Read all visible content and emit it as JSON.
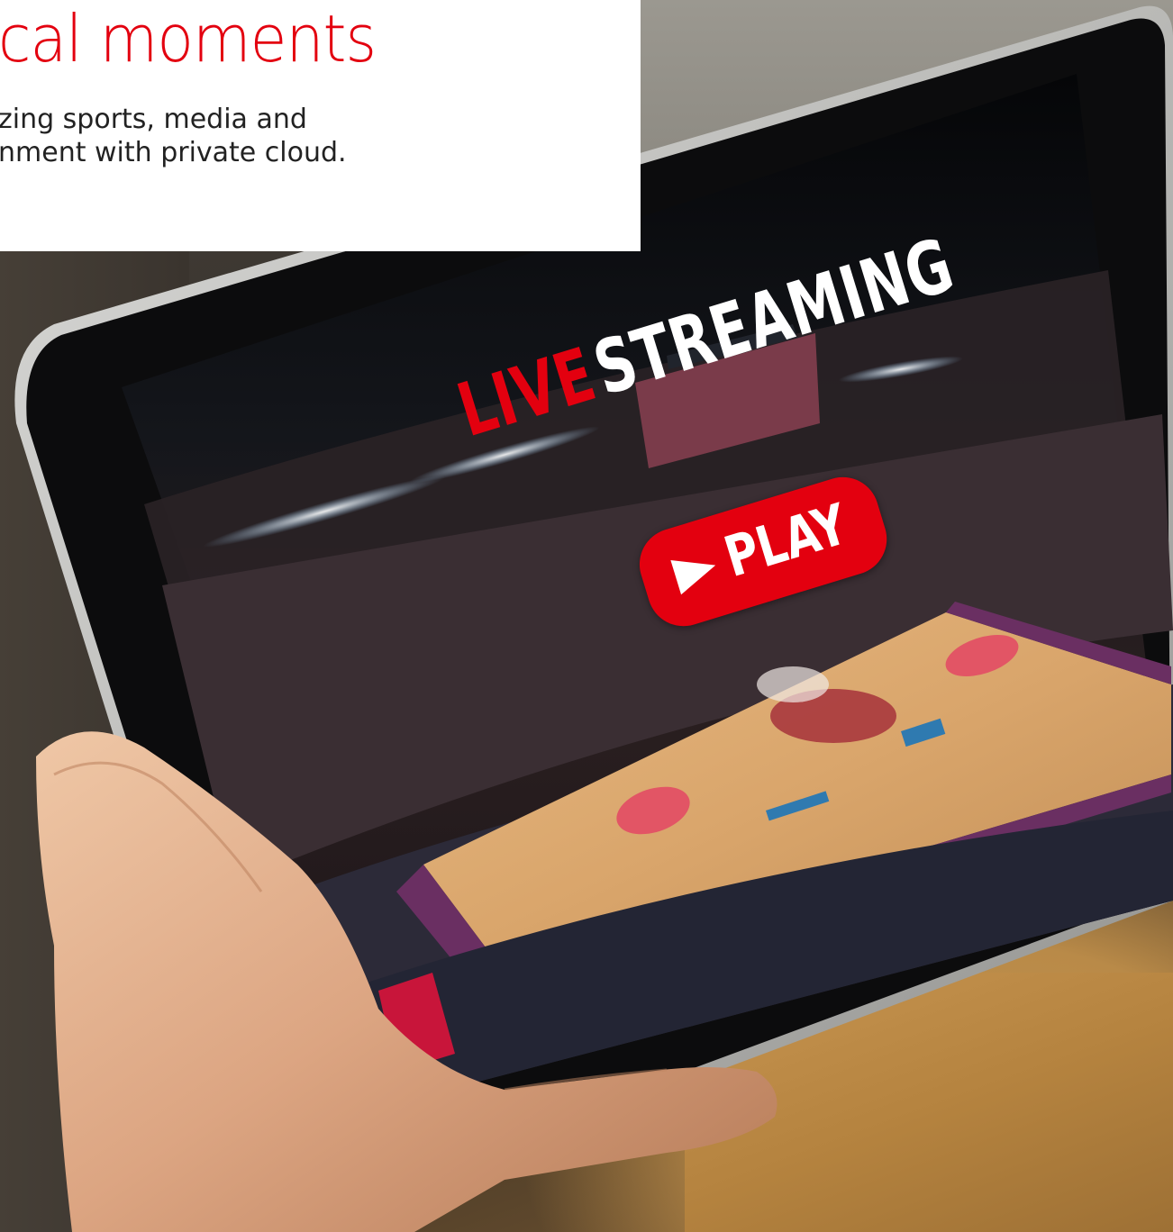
{
  "hero": {
    "title": "cal moments",
    "subtitle_line1": "zing sports, media and",
    "subtitle_line2": "nment with private cloud."
  },
  "stream": {
    "live_word": "LIVE",
    "streaming_word": "STREAMING",
    "play_label": "PLAY"
  },
  "colors": {
    "brand_red": "#e3000f",
    "text_dark": "#222222",
    "card_bg": "#ffffff"
  },
  "icons": {
    "play": "play-triangle-icon"
  }
}
